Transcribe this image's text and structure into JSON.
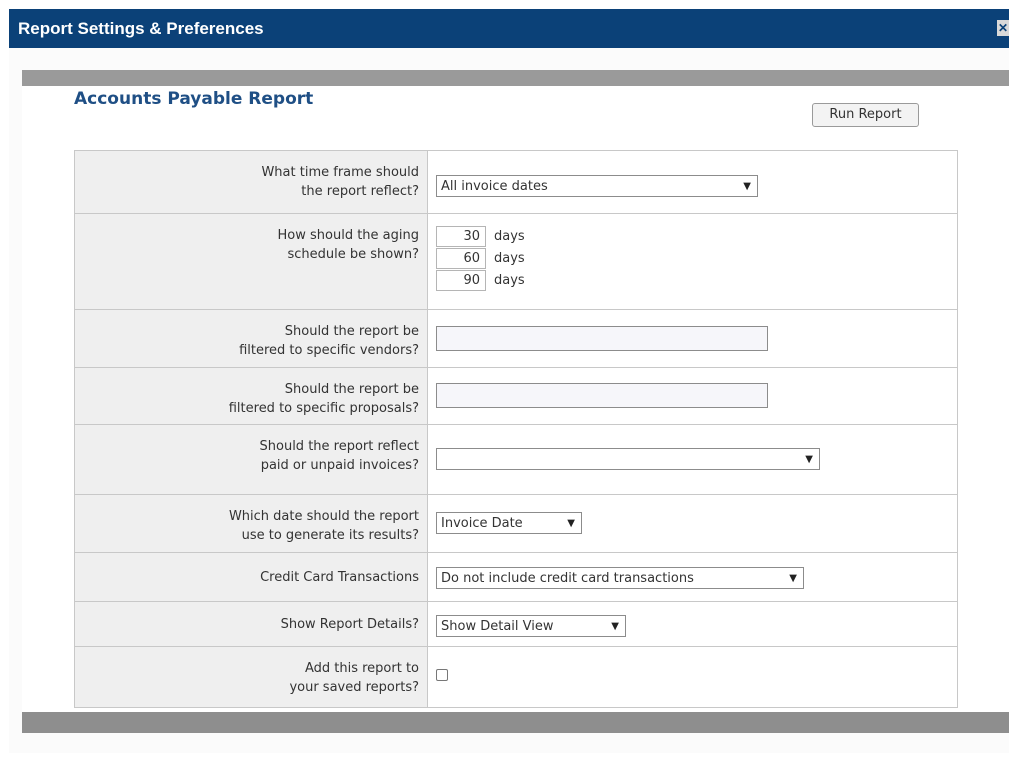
{
  "window": {
    "title": "Report Settings & Preferences",
    "close_label": "✕"
  },
  "report": {
    "title": "Accounts Payable Report",
    "run_button": "Run Report"
  },
  "rows": [
    {
      "question": "What time frame should the report reflect?",
      "control": "select",
      "value": "All invoice dates"
    },
    {
      "question": "How should the aging schedule be shown?",
      "control": "aging",
      "aging": [
        {
          "value": "30",
          "unit": "days"
        },
        {
          "value": "60",
          "unit": "days"
        },
        {
          "value": "90",
          "unit": "days"
        }
      ]
    },
    {
      "question": "Should the report be filtered to specific vendors?",
      "control": "text",
      "value": ""
    },
    {
      "question": "Should the report be filtered to specific proposals?",
      "control": "text",
      "value": ""
    },
    {
      "question": "Should the report reflect paid or unpaid invoices?",
      "control": "select",
      "value": ""
    },
    {
      "question": "Which date should the report use to generate its results?",
      "control": "select",
      "value": "Invoice Date"
    },
    {
      "question": "Credit Card Transactions",
      "control": "select",
      "value": "Do not include credit card transactions"
    },
    {
      "question": "Show Report Details?",
      "control": "select",
      "value": "Show Detail View"
    },
    {
      "question": "Add this report to your saved reports?",
      "control": "checkbox",
      "checked": false
    }
  ],
  "question_lines": [
    [
      "What time frame should",
      "the report reflect?"
    ],
    [
      "How should the aging",
      "schedule be shown?"
    ],
    [
      "Should the report be",
      "filtered to specific vendors?"
    ],
    [
      "Should the report be",
      "filtered to specific proposals?"
    ],
    [
      "Should the report reflect",
      "paid or unpaid invoices?"
    ],
    [
      "Which date should the report",
      "use to generate its results?"
    ],
    [
      "Credit Card Transactions"
    ],
    [
      "Show Report Details?"
    ],
    [
      "Add this report to",
      "your saved reports?"
    ]
  ],
  "icons": {
    "dropdown": "chevron-down-icon",
    "close": "close-icon"
  },
  "colors": {
    "titlebar": "#0b4178",
    "heading": "#1f4f85",
    "question_bg": "#efefef"
  }
}
